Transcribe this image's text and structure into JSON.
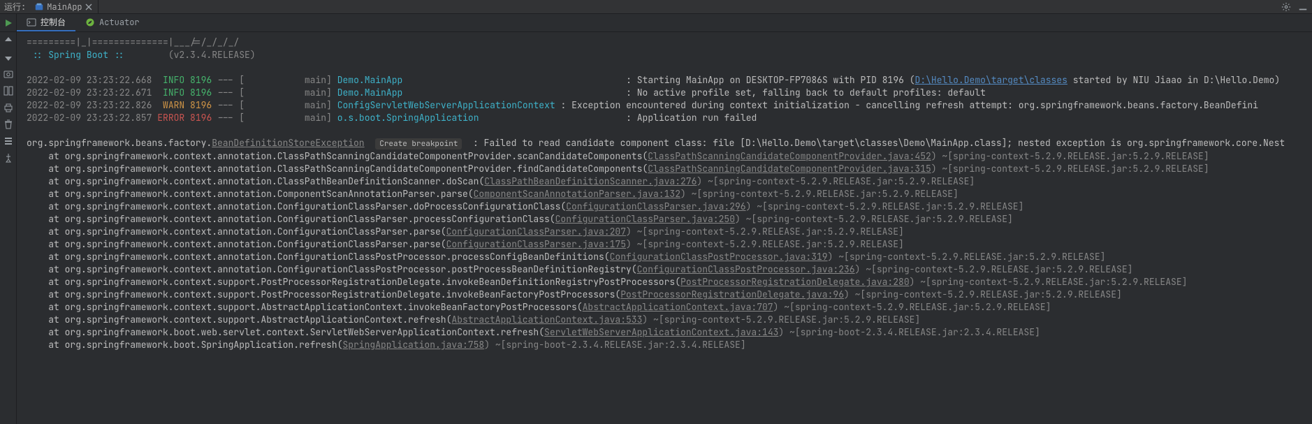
{
  "topbar": {
    "run_label": "运行:",
    "tab_name": "MainApp",
    "tab_close_icon": "close-icon",
    "tools": {
      "settings_icon": "gear-icon",
      "minimize_icon": "minimize-icon"
    }
  },
  "subbar": {
    "run_icon": "play-icon",
    "tabs": [
      {
        "id": "console",
        "label": "控制台",
        "icon": "console-icon",
        "active": true
      },
      {
        "id": "actuator",
        "label": "Actuator",
        "icon": "spring-icon",
        "active": false
      }
    ]
  },
  "gutter_icons": [
    "arrow-up-icon",
    "arrow-down-icon",
    "snapshot-icon",
    "layout-icon",
    "print-icon",
    "trash-icon",
    "stack-icon",
    "pin-icon"
  ],
  "banner": {
    "line1": "=========|_|==============|___/=/_/_/_/",
    "boot": ":: Spring Boot ::",
    "ver": "(v2.3.4.RELEASE)"
  },
  "logs": [
    {
      "ts": "2022-02-09 23:23:22.668",
      "level": "INFO",
      "pid": "8196",
      "sep": "--- [",
      "thread": "main]",
      "logger": "Demo.MainApp",
      "msg_pre": ": Starting MainApp on DESKTOP-FP7086S with PID 8196 (",
      "link": "D:\\Hello.Demo\\target\\classes",
      "msg_post": " started by NIU Jiaao in D:\\Hello.Demo)"
    },
    {
      "ts": "2022-02-09 23:23:22.671",
      "level": "INFO",
      "pid": "8196",
      "sep": "--- [",
      "thread": "main]",
      "logger": "Demo.MainApp",
      "msg": ": No active profile set, falling back to default profiles: default"
    },
    {
      "ts": "2022-02-09 23:23:22.826",
      "level": "WARN",
      "pid": "8196",
      "sep": "--- [",
      "thread": "main]",
      "logger": "ConfigServletWebServerApplicationContext",
      "msg": ": Exception encountered during context initialization - cancelling refresh attempt: org.springframework.beans.factory.BeanDefini"
    },
    {
      "ts": "2022-02-09 23:23:22.857",
      "level": "ERROR",
      "pid": "8196",
      "sep": "--- [",
      "thread": "main]",
      "logger": "o.s.boot.SpringApplication",
      "msg": ": Application run failed"
    }
  ],
  "exception": {
    "prefix": "org.springframework.beans.factory.",
    "class": "BeanDefinitionStoreException",
    "breakpoint": "Create breakpoint",
    "msg": ": Failed to read candidate component class: file [D:\\Hello.Demo\\target\\classes\\Demo\\MainApp.class]; nested exception is org.springframework.core.Nest"
  },
  "stack": [
    {
      "at": "    at org.springframework.context.annotation.ClassPathScanningCandidateComponentProvider.scanCandidateComponents(",
      "src": "ClassPathScanningCandidateComponentProvider.java:452",
      "jar": ") ~[spring-context-5.2.9.RELEASE.jar:5.2.9.RELEASE]"
    },
    {
      "at": "    at org.springframework.context.annotation.ClassPathScanningCandidateComponentProvider.findCandidateComponents(",
      "src": "ClassPathScanningCandidateComponentProvider.java:315",
      "jar": ") ~[spring-context-5.2.9.RELEASE.jar:5.2.9.RELEASE]"
    },
    {
      "at": "    at org.springframework.context.annotation.ClassPathBeanDefinitionScanner.doScan(",
      "src": "ClassPathBeanDefinitionScanner.java:276",
      "jar": ") ~[spring-context-5.2.9.RELEASE.jar:5.2.9.RELEASE]"
    },
    {
      "at": "    at org.springframework.context.annotation.ComponentScanAnnotationParser.parse(",
      "src": "ComponentScanAnnotationParser.java:132",
      "jar": ") ~[spring-context-5.2.9.RELEASE.jar:5.2.9.RELEASE]"
    },
    {
      "at": "    at org.springframework.context.annotation.ConfigurationClassParser.doProcessConfigurationClass(",
      "src": "ConfigurationClassParser.java:296",
      "jar": ") ~[spring-context-5.2.9.RELEASE.jar:5.2.9.RELEASE]"
    },
    {
      "at": "    at org.springframework.context.annotation.ConfigurationClassParser.processConfigurationClass(",
      "src": "ConfigurationClassParser.java:250",
      "jar": ") ~[spring-context-5.2.9.RELEASE.jar:5.2.9.RELEASE]"
    },
    {
      "at": "    at org.springframework.context.annotation.ConfigurationClassParser.parse(",
      "src": "ConfigurationClassParser.java:207",
      "jar": ") ~[spring-context-5.2.9.RELEASE.jar:5.2.9.RELEASE]"
    },
    {
      "at": "    at org.springframework.context.annotation.ConfigurationClassParser.parse(",
      "src": "ConfigurationClassParser.java:175",
      "jar": ") ~[spring-context-5.2.9.RELEASE.jar:5.2.9.RELEASE]"
    },
    {
      "at": "    at org.springframework.context.annotation.ConfigurationClassPostProcessor.processConfigBeanDefinitions(",
      "src": "ConfigurationClassPostProcessor.java:319",
      "jar": ") ~[spring-context-5.2.9.RELEASE.jar:5.2.9.RELEASE]"
    },
    {
      "at": "    at org.springframework.context.annotation.ConfigurationClassPostProcessor.postProcessBeanDefinitionRegistry(",
      "src": "ConfigurationClassPostProcessor.java:236",
      "jar": ") ~[spring-context-5.2.9.RELEASE.jar:5.2.9.RELEASE]"
    },
    {
      "at": "    at org.springframework.context.support.PostProcessorRegistrationDelegate.invokeBeanDefinitionRegistryPostProcessors(",
      "src": "PostProcessorRegistrationDelegate.java:280",
      "jar": ") ~[spring-context-5.2.9.RELEASE.jar:5.2.9.RELEASE]"
    },
    {
      "at": "    at org.springframework.context.support.PostProcessorRegistrationDelegate.invokeBeanFactoryPostProcessors(",
      "src": "PostProcessorRegistrationDelegate.java:96",
      "jar": ") ~[spring-context-5.2.9.RELEASE.jar:5.2.9.RELEASE]"
    },
    {
      "at": "    at org.springframework.context.support.AbstractApplicationContext.invokeBeanFactoryPostProcessors(",
      "src": "AbstractApplicationContext.java:707",
      "jar": ") ~[spring-context-5.2.9.RELEASE.jar:5.2.9.RELEASE]"
    },
    {
      "at": "    at org.springframework.context.support.AbstractApplicationContext.refresh(",
      "src": "AbstractApplicationContext.java:533",
      "jar": ") ~[spring-context-5.2.9.RELEASE.jar:5.2.9.RELEASE]"
    },
    {
      "at": "    at org.springframework.boot.web.servlet.context.ServletWebServerApplicationContext.refresh(",
      "src": "ServletWebServerApplicationContext.java:143",
      "jar": ") ~[spring-boot-2.3.4.RELEASE.jar:2.3.4.RELEASE]"
    },
    {
      "at": "    at org.springframework.boot.SpringApplication.refresh(",
      "src": "SpringApplication.java:758",
      "jar": ") ~[spring-boot-2.3.4.RELEASE.jar:2.3.4.RELEASE]"
    }
  ]
}
